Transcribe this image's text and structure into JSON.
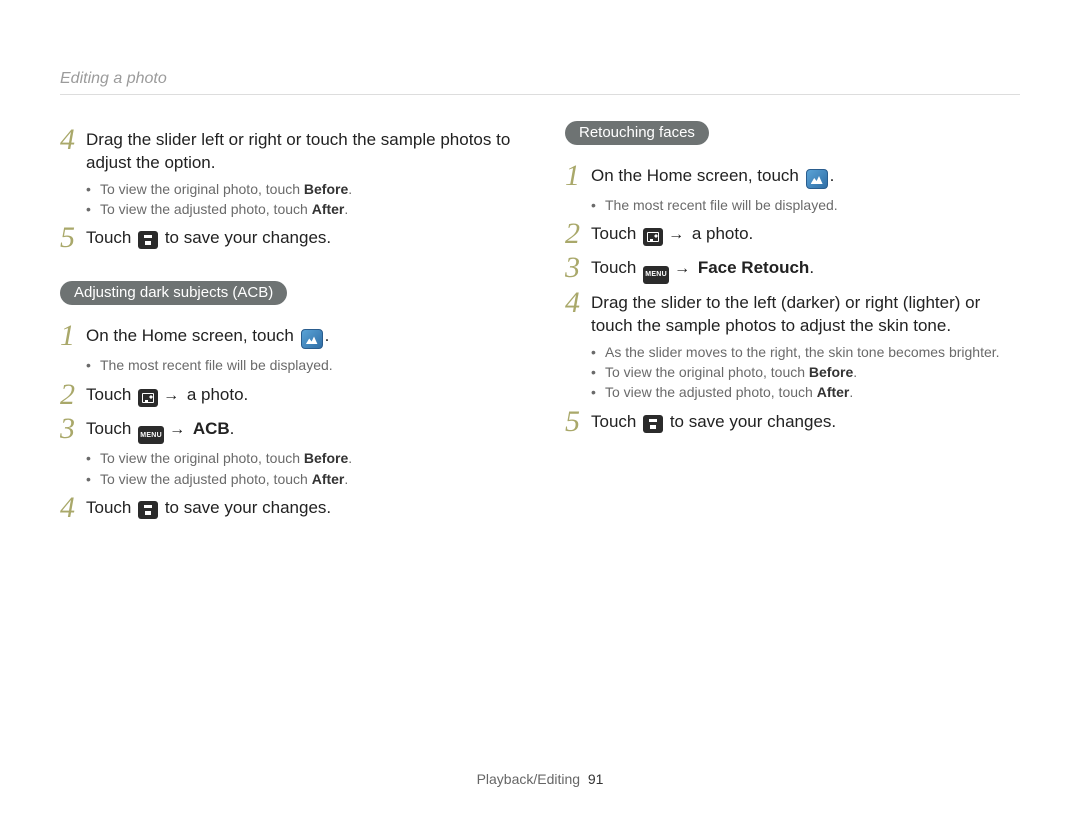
{
  "breadcrumb": "Editing a photo",
  "footer_section": "Playback/Editing",
  "footer_page": "91",
  "icons": {
    "save": "save-icon",
    "home_photo": "photo-app-icon",
    "browse": "photo-browse-icon",
    "menu": "menu-icon",
    "arrow": "→"
  },
  "left": {
    "step4": "Drag the slider left or right or touch the sample photos to adjust the option.",
    "step4_sub1a": "To view the original photo, touch ",
    "step4_sub1b": "Before",
    "step4_sub2a": "To view the adjusted photo, touch ",
    "step4_sub2b": "After",
    "step5a": "Touch ",
    "step5b": " to save your changes.",
    "acb_heading": "Adjusting dark subjects (ACB)",
    "acb1a": "On the Home screen, touch ",
    "acb1_sub": "The most recent file will be displayed.",
    "acb2a": "Touch ",
    "acb2b": " a photo.",
    "acb3a": "Touch ",
    "acb3b": "ACB",
    "acb3_sub1a": "To view the original photo, touch ",
    "acb3_sub1b": "Before",
    "acb3_sub2a": "To view the adjusted photo, touch ",
    "acb3_sub2b": "After",
    "acb4a": "Touch ",
    "acb4b": " to save your changes."
  },
  "right": {
    "rf_heading": "Retouching faces",
    "rf1a": "On the Home screen, touch ",
    "rf1_sub": "The most recent file will be displayed.",
    "rf2a": "Touch ",
    "rf2b": " a photo.",
    "rf3a": "Touch ",
    "rf3b": "Face Retouch",
    "rf4": "Drag the slider to the left (darker) or right (lighter) or touch the sample photos to adjust the skin tone.",
    "rf4_sub1": "As the slider moves to the right, the skin tone becomes brighter.",
    "rf4_sub2a": "To view the original photo, touch ",
    "rf4_sub2b": "Before",
    "rf4_sub3a": "To view the adjusted photo, touch ",
    "rf4_sub3b": "After",
    "rf5a": "Touch ",
    "rf5b": " to save your changes."
  }
}
